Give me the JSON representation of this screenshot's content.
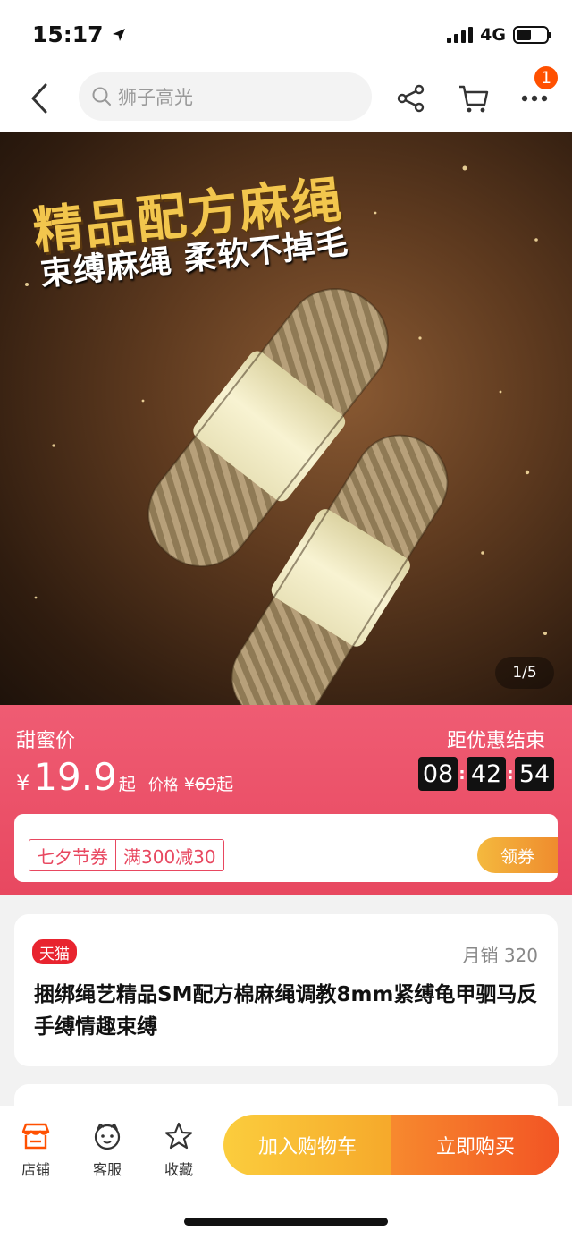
{
  "status_bar": {
    "time": "15:17",
    "network": "4G",
    "icons": [
      "location-arrow-icon",
      "signal-icon",
      "battery-icon"
    ]
  },
  "nav": {
    "search_placeholder": "狮子高光",
    "more_badge": "1",
    "icons": [
      "back-icon",
      "search-icon",
      "share-icon",
      "cart-icon",
      "more-icon"
    ]
  },
  "hero": {
    "headline": "精品配方麻绳",
    "subheadline": "束缚麻绳 柔软不掉毛",
    "counter": "1/5"
  },
  "price": {
    "label": "甜蜜价",
    "currency": "¥",
    "current": "19.9",
    "current_suffix": "起",
    "original_label": "价格",
    "original_currency": "¥",
    "original": "69",
    "original_suffix": "起",
    "countdown_label": "距优惠结束",
    "countdown": {
      "hours": "08",
      "minutes": "42",
      "seconds": "54"
    },
    "colors": {
      "panel": "#e84860",
      "countdown_box": "#111111"
    }
  },
  "coupon": {
    "tag_name": "七夕节券",
    "tag_rule": "满300减30",
    "claim_label": "领券"
  },
  "product": {
    "store_badge": "天猫",
    "monthly_sales": "月销 320",
    "title": "捆绑绳艺精品SM配方棉麻绳调教8mm紧缚龟甲驷马反手缚情趣束缚"
  },
  "bottom_bar": {
    "tabs": [
      {
        "label": "店铺",
        "icon": "store-icon"
      },
      {
        "label": "客服",
        "icon": "customer-service-icon"
      },
      {
        "label": "收藏",
        "icon": "star-icon"
      }
    ],
    "add_to_cart": "加入购物车",
    "buy_now": "立即购买",
    "colors": {
      "accent": "#ff5000",
      "cart": "#f6a92b",
      "buy": "#f25424"
    }
  }
}
